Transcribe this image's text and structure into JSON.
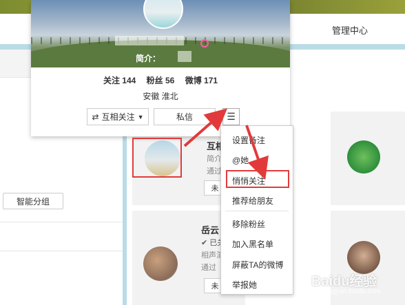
{
  "nav": {
    "manage_center": "管理中心"
  },
  "left": {
    "smart_group_button": "智能分组"
  },
  "profile": {
    "intro_label": "简介：",
    "stats": {
      "following": "关注 144",
      "followers": "粉丝 56",
      "weibo": "微博 171"
    },
    "location": "安徽 淮北",
    "mutual_follow_button": "互相关注",
    "message_button": "私信"
  },
  "menu": {
    "items": [
      "设置备注",
      "@她",
      "悄悄关注",
      "推荐给朋友",
      "移除粉丝",
      "加入黑名单",
      "屏蔽TA的微博",
      "举报她"
    ],
    "highlighted": "悄悄关注"
  },
  "cards": {
    "card1": {
      "name_prefix": "互相",
      "intro": "简介：",
      "via": "通过",
      "button": "未"
    },
    "card2": {
      "name": "岳云",
      "status": "已关",
      "bio": "相声演",
      "via": "通过",
      "button": "未"
    }
  },
  "watermark": {
    "brand": "Baidu经验",
    "url": "jingyan.baidu.com"
  },
  "colors": {
    "annotation_red": "#e23a3a",
    "highlight_pink": "#ff5ca8"
  }
}
